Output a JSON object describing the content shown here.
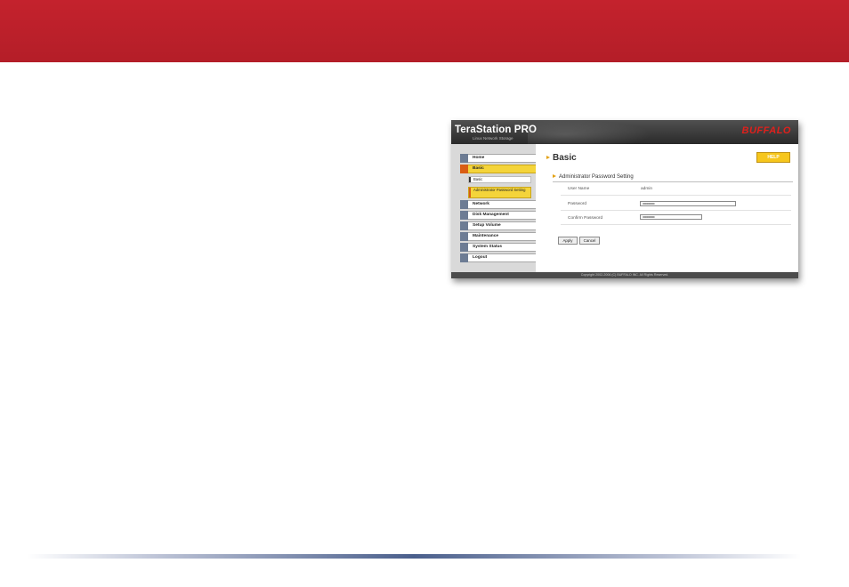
{
  "header": {
    "brand": "TeraStation PRO",
    "brand_subtitle": "Linux Network Storage",
    "logo": "BUFFALO"
  },
  "sidebar": {
    "items": [
      {
        "label": "Home",
        "icon": "home-icon"
      },
      {
        "label": "Basic",
        "icon": "basic-icon"
      },
      {
        "label": "Basic",
        "sub": true
      },
      {
        "label": "Administrator Password Setting",
        "sub": true
      },
      {
        "label": "Network",
        "icon": "network-icon"
      },
      {
        "label": "Disk Management",
        "icon": "disk-icon"
      },
      {
        "label": "Setup Volume",
        "icon": "volume-icon"
      },
      {
        "label": "Maintenance",
        "icon": "maintenance-icon"
      },
      {
        "label": "System Status",
        "icon": "status-icon"
      },
      {
        "label": "Logout",
        "icon": "logout-icon"
      }
    ]
  },
  "main": {
    "title": "Basic",
    "help_label": "HELP",
    "section_title": "Administrator Password Setting",
    "user_name_label": "User Name",
    "user_name_value": "admin",
    "password_label": "Password",
    "password_value": "••••••••••••••••••••",
    "confirm_label": "Confirm Password",
    "confirm_value": "••••••••••••••••••••",
    "apply_label": "Apply",
    "cancel_label": "Cancel"
  },
  "footer": {
    "copyright": "Copyright 2002-2006 (C) BUFFALO INC. All Rights Reserved."
  },
  "colors": {
    "banner": "#c4222d",
    "accent": "#f4d43a",
    "brand_logo": "#e0201c"
  }
}
